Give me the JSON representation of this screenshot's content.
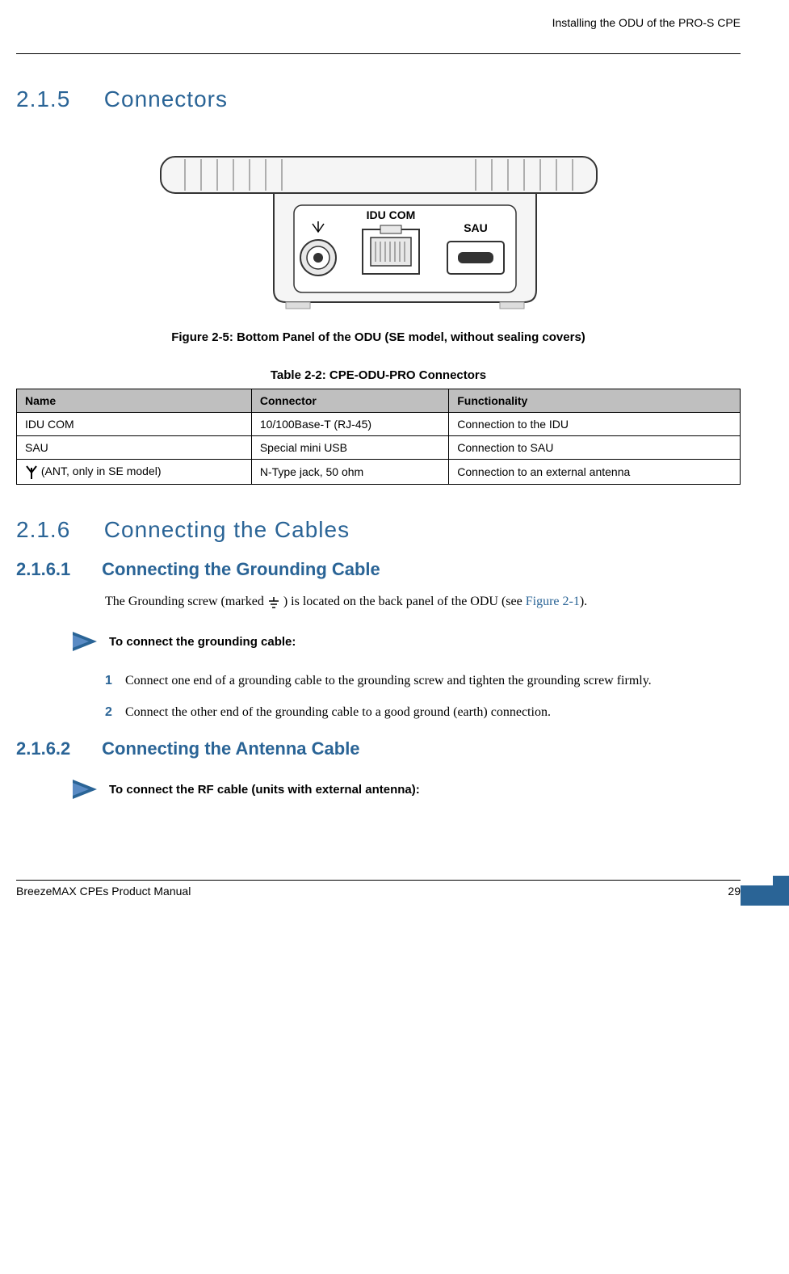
{
  "header": {
    "title": "Installing the ODU of the PRO-S CPE"
  },
  "section_215": {
    "number": "2.1.5",
    "title": "Connectors"
  },
  "figure_25": {
    "caption": "Figure 2-5: Bottom Panel of the ODU (SE model, without sealing covers)",
    "labels": {
      "idu_com": "IDU COM",
      "sau": "SAU"
    }
  },
  "table_22": {
    "caption": "Table 2-2: CPE-ODU-PRO Connectors",
    "headers": [
      "Name",
      "Connector",
      "Functionality"
    ],
    "rows": [
      {
        "name": "IDU COM",
        "connector": "10/100Base-T (RJ-45)",
        "functionality": "Connection to the IDU"
      },
      {
        "name": "SAU",
        "connector": "Special mini USB",
        "functionality": "Connection to SAU"
      },
      {
        "name": " (ANT, only in SE model)",
        "connector": "N-Type jack, 50 ohm",
        "functionality": "Connection to an external antenna"
      }
    ]
  },
  "section_216": {
    "number": "2.1.6",
    "title": "Connecting the Cables"
  },
  "section_2161": {
    "number": "2.1.6.1",
    "title": "Connecting the Grounding Cable"
  },
  "body_2161": {
    "text_before": "The Grounding screw (marked ",
    "text_after": ") is located on the back panel of the ODU (see ",
    "figure_ref": "Figure 2-1",
    "text_end": ")."
  },
  "procedure_1": {
    "title": "To connect the grounding cable:",
    "steps": [
      {
        "num": "1",
        "text": "Connect one end of a grounding cable to the grounding screw and tighten the grounding screw firmly."
      },
      {
        "num": "2",
        "text": "Connect the other end of the grounding cable to a good ground (earth) connection."
      }
    ]
  },
  "section_2162": {
    "number": "2.1.6.2",
    "title": "Connecting the Antenna Cable"
  },
  "procedure_2": {
    "title": "To connect the RF cable (units with external antenna):"
  },
  "footer": {
    "manual_name": "BreezeMAX CPEs Product Manual",
    "page_number": "29"
  }
}
